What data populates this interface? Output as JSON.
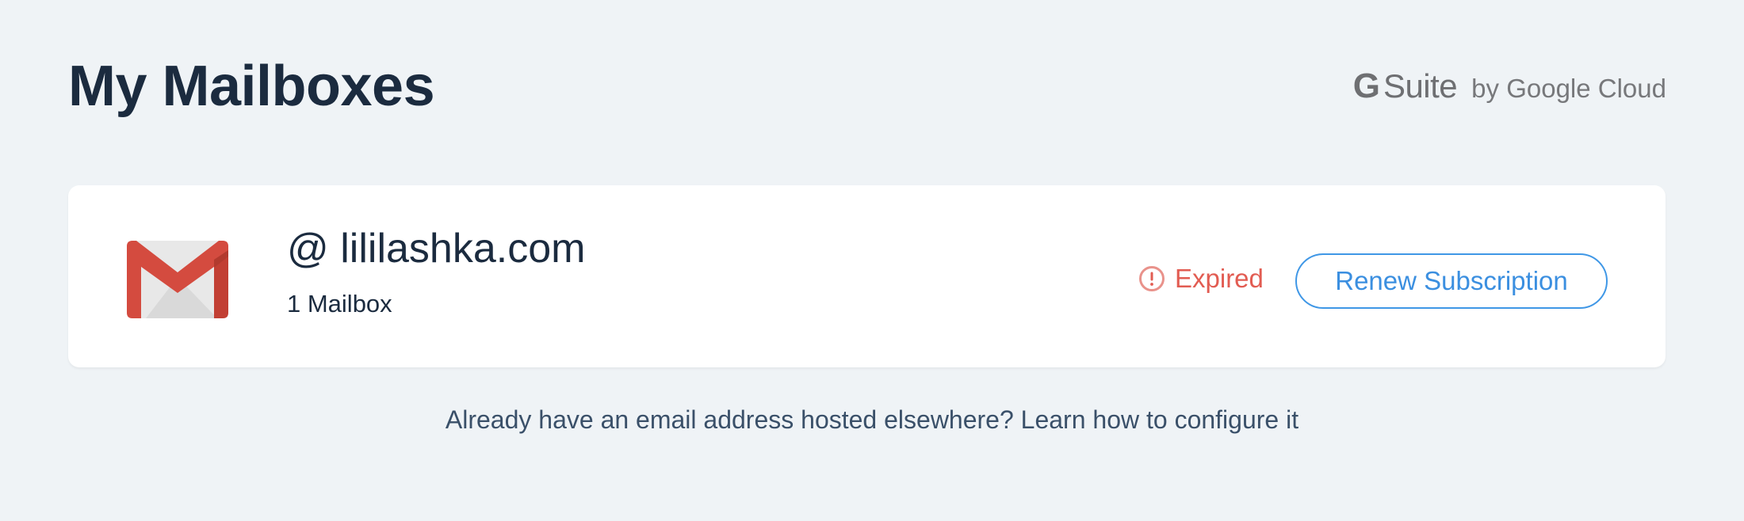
{
  "header": {
    "title": "My Mailboxes"
  },
  "brand": {
    "g": "G",
    "suite": "Suite",
    "by": "by Google Cloud"
  },
  "mailbox": {
    "domain": "@ lililashka.com",
    "count_label": "1 Mailbox",
    "status_label": "Expired",
    "renew_label": "Renew Subscription",
    "logo_icon": "gmail-icon",
    "status_icon": "alert-circle-icon"
  },
  "footer": {
    "question": "Already have an email address hosted elsewhere? ",
    "link_label": "Learn how to configure it"
  },
  "colors": {
    "background": "#eff3f6",
    "expired": "#e25c52",
    "accent": "#3f97e6"
  }
}
